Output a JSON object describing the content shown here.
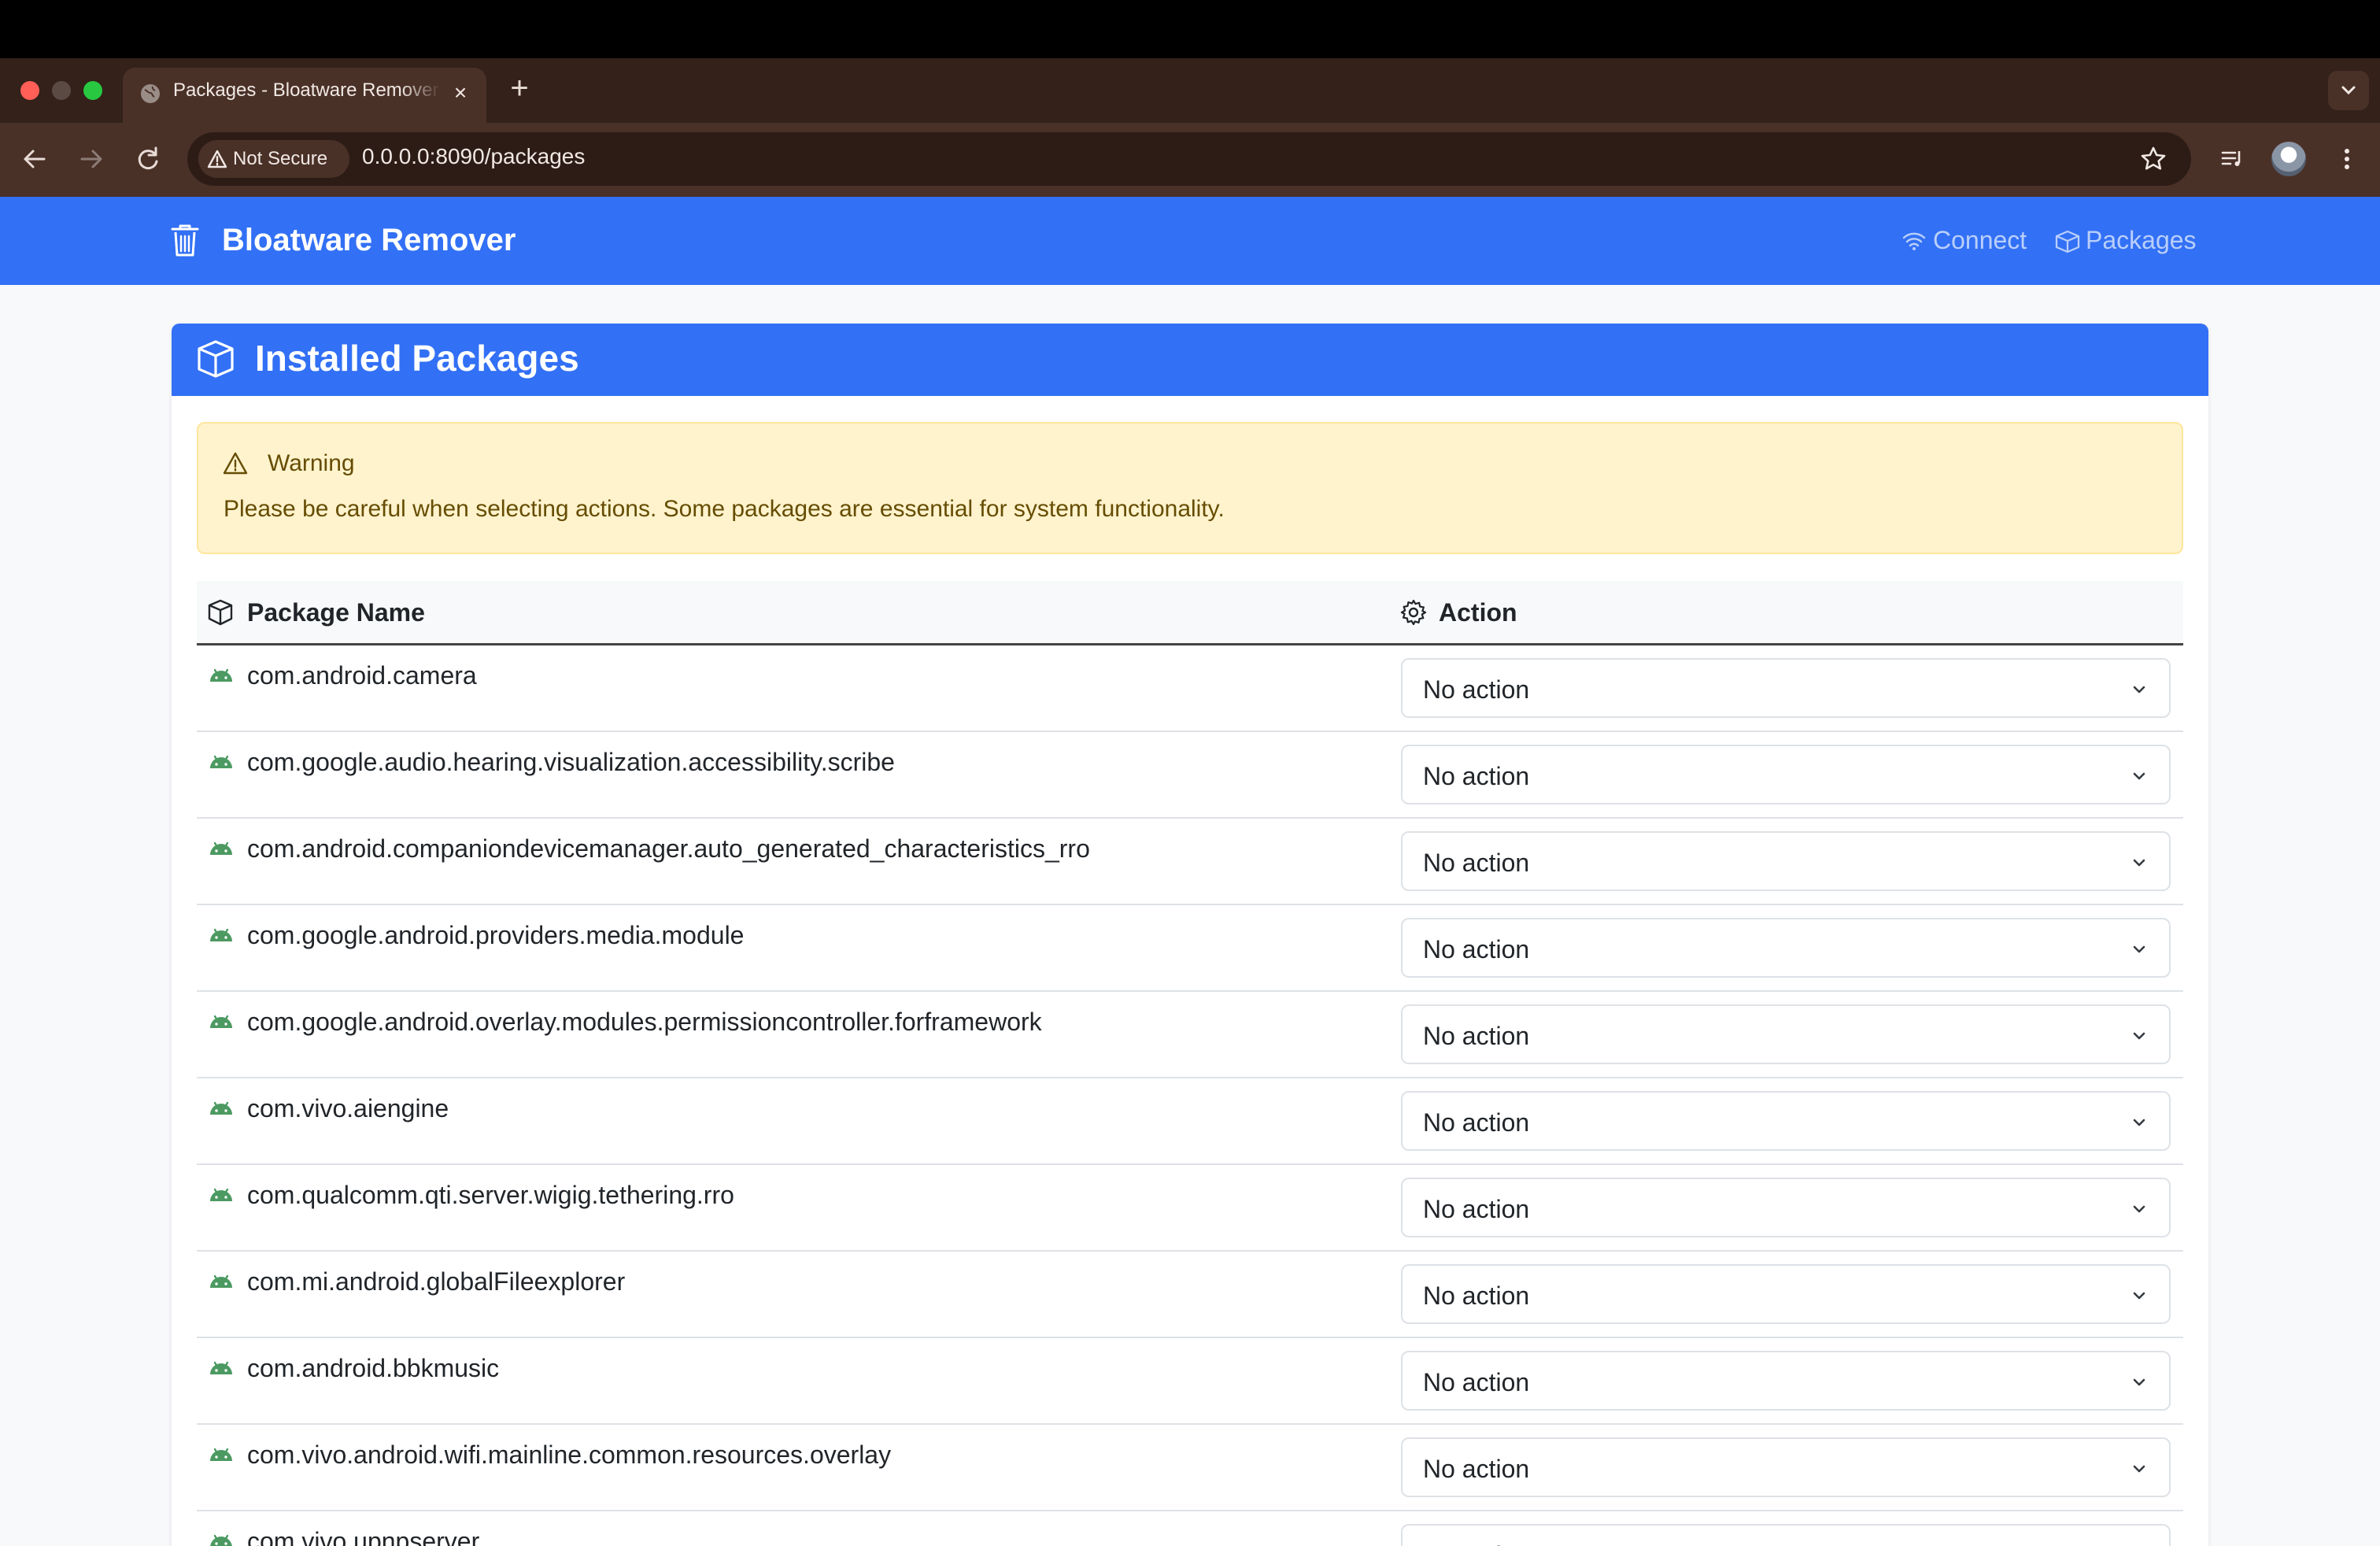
{
  "browser": {
    "tab_title": "Packages - Bloatware Remover",
    "new_tab_label": "+",
    "close_tab_label": "×",
    "security_chip": "Not Secure",
    "url": "0.0.0.0:8090/packages"
  },
  "navbar": {
    "brand": "Bloatware Remover",
    "links": [
      {
        "label": "Connect",
        "icon": "wifi-icon"
      },
      {
        "label": "Packages",
        "icon": "box-icon"
      }
    ]
  },
  "card": {
    "title": "Installed Packages",
    "alert": {
      "title": "Warning",
      "message": "Please be careful when selecting actions. Some packages are essential for system functionality."
    },
    "table": {
      "headers": [
        "Package Name",
        "Action"
      ],
      "rows": [
        {
          "name": "com.android.camera",
          "action": "No action"
        },
        {
          "name": "com.google.audio.hearing.visualization.accessibility.scribe",
          "action": "No action"
        },
        {
          "name": "com.android.companiondevicemanager.auto_generated_characteristics_rro",
          "action": "No action"
        },
        {
          "name": "com.google.android.providers.media.module",
          "action": "No action"
        },
        {
          "name": "com.google.android.overlay.modules.permissioncontroller.forframework",
          "action": "No action"
        },
        {
          "name": "com.vivo.aiengine",
          "action": "No action"
        },
        {
          "name": "com.qualcomm.qti.server.wigig.tethering.rro",
          "action": "No action"
        },
        {
          "name": "com.mi.android.globalFileexplorer",
          "action": "No action"
        },
        {
          "name": "com.android.bbkmusic",
          "action": "No action"
        },
        {
          "name": "com.vivo.android.wifi.mainline.common.resources.overlay",
          "action": "No action"
        },
        {
          "name": "com.vivo.upnpserver",
          "action": "No action"
        }
      ]
    }
  },
  "colors": {
    "primary": "#3270f5",
    "warning_bg": "#fff3cd",
    "warning_text": "#664d03",
    "android_green": "#3ddc84"
  }
}
